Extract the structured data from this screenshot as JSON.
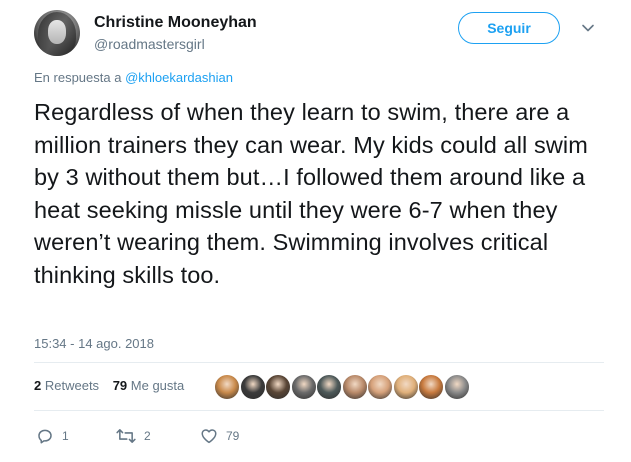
{
  "author": {
    "name": "Christine Mooneyhan",
    "handle": "@roadmastersgirl"
  },
  "follow_button": "Seguir",
  "reply_context": {
    "prefix": "En respuesta a",
    "mention": "@khloekardashian"
  },
  "tweet": {
    "text": "Regardless of when they learn to swim, there are a million trainers they can wear. My kids could all swim by 3 without them but…I followed them around like a heat seeking missle until they were 6-7 when they weren’t wearing them. Swimming involves critical thinking skills too.",
    "timestamp": "15:34 - 14 ago. 2018"
  },
  "stats": {
    "retweets_count": "2",
    "retweets_label": "Retweets",
    "likes_count": "79",
    "likes_label": "Me gusta"
  },
  "actions": {
    "reply_count": "1",
    "retweet_count": "2",
    "like_count": "79"
  },
  "liker_avatars": [
    "#c98a4b",
    "#3b3b3b",
    "#5a4636",
    "#6b6b6b",
    "#4e5a5a",
    "#b98a6a",
    "#d6a17a",
    "#e0b07a",
    "#c87a3e",
    "#8a8a8a"
  ],
  "colors": {
    "accent": "#1da1f2",
    "secondary_text": "#657786",
    "primary_text": "#14171a"
  }
}
